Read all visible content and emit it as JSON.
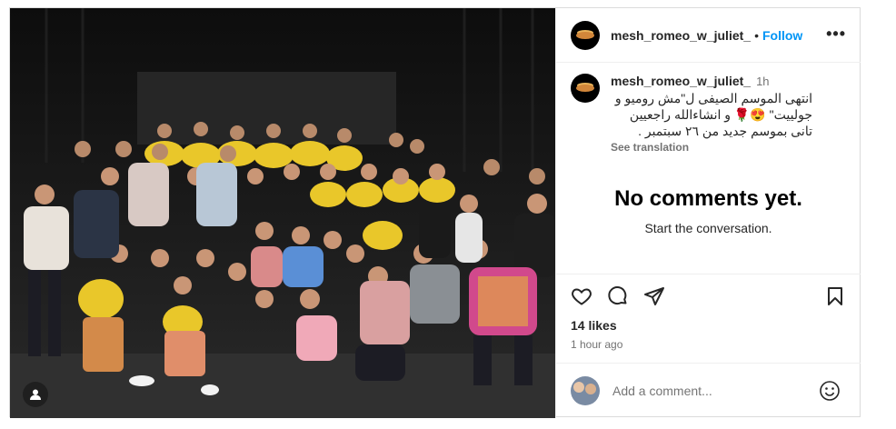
{
  "post": {
    "username": "mesh_romeo_w_juliet_",
    "dot": "•",
    "follow_label": "Follow",
    "more_label": "•••",
    "caption_username": "mesh_romeo_w_juliet_",
    "caption_time": "1h",
    "caption_text": "انتهى الموسم الصيفى ل\"مش روميو و جولييت\" 😍🌹 و انشاءالله راجعيين تانى بموسم جديد من ٢٦ سبتمبر .",
    "see_translation": "See translation",
    "no_comments_title": "No comments yet.",
    "no_comments_sub": "Start the conversation.",
    "likes": "14 likes",
    "time_ago": "1 hour ago",
    "comment_placeholder": "Add a comment..."
  },
  "icons": {
    "like": "heart-icon",
    "comment": "comment-icon",
    "share": "send-icon",
    "save": "bookmark-icon",
    "emoji": "smiley-icon",
    "tag": "user-tag-icon"
  },
  "colors": {
    "link_blue": "#0095f6",
    "muted": "#737373",
    "border": "#dbdbdb"
  }
}
